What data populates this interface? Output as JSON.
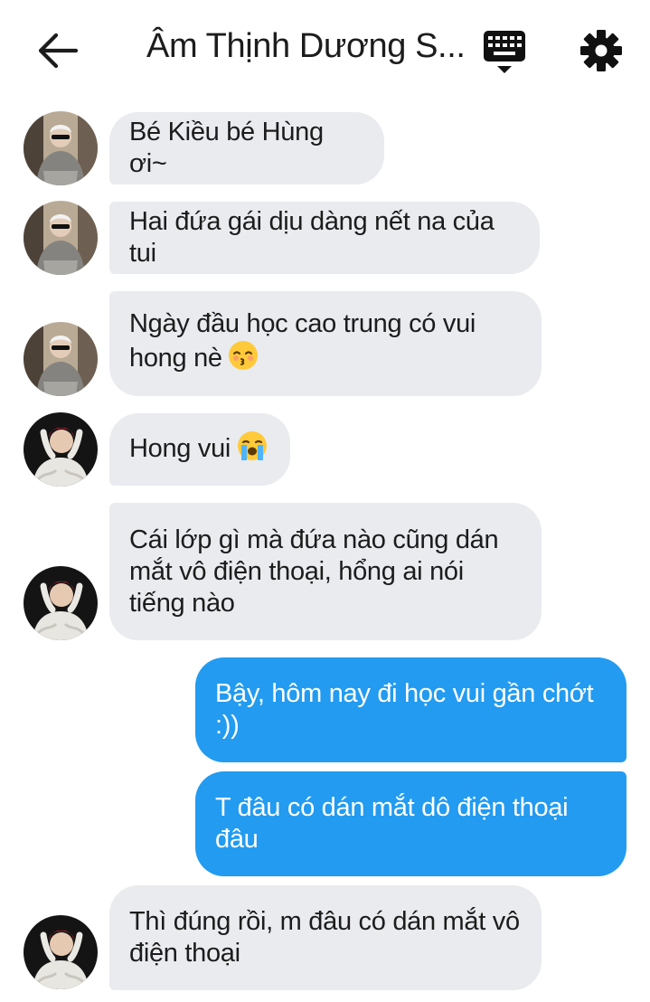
{
  "header": {
    "title": "Âm Thịnh Dương S...",
    "back_icon": "arrow-left-icon",
    "keyboard_icon": "keyboard-icon",
    "settings_icon": "gear-icon"
  },
  "messages": [
    {
      "side": "in",
      "sender": "avatar-a",
      "text": "Bé Kiều bé Hùng ơi~"
    },
    {
      "side": "in",
      "sender": "avatar-a",
      "text": "Hai đứa gái dịu dàng nết na của tui"
    },
    {
      "side": "in",
      "sender": "avatar-a",
      "text": "Ngày đầu học cao trung có vui hong nè",
      "emoji": "kissing-emoji"
    },
    {
      "side": "in",
      "sender": "avatar-b",
      "text": "Hong vui",
      "emoji": "crying-emoji"
    },
    {
      "side": "in",
      "sender": "avatar-b",
      "text": "Cái lớp gì mà đứa nào cũng dán mắt vô điện thoại, hổng ai nói tiếng nào"
    },
    {
      "side": "out",
      "text": "Bậy, hôm nay đi học vui gần chớt :))"
    },
    {
      "side": "out",
      "text": "T đâu có dán mắt dô điện thoại đâu"
    },
    {
      "side": "in",
      "sender": "avatar-b",
      "text": "Thì đúng rồi, m đâu có dán mắt vô điện thoại"
    }
  ],
  "colors": {
    "incoming_bubble": "#e9ebef",
    "outgoing_bubble": "#229bf0",
    "outgoing_text": "#ffffff",
    "incoming_text": "#1c1c1c"
  }
}
